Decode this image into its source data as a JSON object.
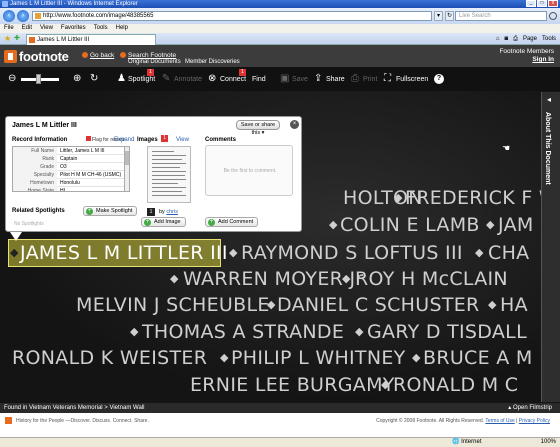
{
  "browser": {
    "title": "James L M Littler III - Windows Internet Explorer",
    "url": "http://www.footnote.com/image/48385565",
    "search_placeholder": "Live Search",
    "menu": [
      "File",
      "Edit",
      "View",
      "Favorites",
      "Tools",
      "Help"
    ],
    "tab_label": "James L M Littler III",
    "commands": [
      "Page",
      "Tools"
    ],
    "status_zone": "Internet",
    "zoom": "100%"
  },
  "header": {
    "logo_text": "footnote",
    "go_back": "Go back",
    "search_footnote": "Search Footnote",
    "original_documents": "Original Documents",
    "member_discoveries": "Member Discoveries",
    "footnote_members": "Footnote Members",
    "sign_in": "Sign In"
  },
  "toolbar": {
    "spotlight": "Spotlight",
    "spotlight_badge": "1",
    "annotate": "Annotate",
    "connect": "Connect",
    "connect_badge": "1",
    "find": "Find",
    "save": "Save",
    "share": "Share",
    "print": "Print",
    "fullscreen": "Fullscreen",
    "help": "?",
    "zoom_level": 0.45
  },
  "side_tab": {
    "label": "About This Document"
  },
  "card": {
    "title": "James L M Littler III",
    "save_share": "Save or share this",
    "record_info_label": "Record Information",
    "flag_label": "Flag for review",
    "expand": "Expand",
    "record_rows": [
      {
        "key": "Full Name",
        "value": "Littler, James L M III"
      },
      {
        "key": "Rank",
        "value": "Captain"
      },
      {
        "key": "Grade",
        "value": "O3"
      },
      {
        "key": "Specialty",
        "value": "Pilot H M M CH-46 (USMC)"
      },
      {
        "key": "Hometown",
        "value": "Honolulu"
      },
      {
        "key": "Home State",
        "value": "HI"
      }
    ],
    "images_label": "Images",
    "images_badge": "1",
    "view": "View",
    "image_number": "1",
    "by_label": "by",
    "by_user": "chris",
    "comments_label": "Comments",
    "first_comment": "Be the first to comment.",
    "related_spotlights": "Related Spotlights",
    "no_spotlights": "No Spotlights",
    "make_spotlight": "Make Spotlight",
    "add_image": "Add Image",
    "add_comment": "Add Comment"
  },
  "wall": {
    "names": [
      {
        "text": "HOLTON"
      },
      {
        "text": "FREDERICK F W"
      },
      {
        "text": "COLIN E LAMB"
      },
      {
        "text": "JAM"
      },
      {
        "text": "JAMES L M LITTLER III"
      },
      {
        "text": "RAYMOND S LOFTUS III"
      },
      {
        "text": "CHA"
      },
      {
        "text": "WARREN MOYER Jr"
      },
      {
        "text": "ROY H McCLAIN"
      },
      {
        "text": "MELVIN J SCHEUBLE"
      },
      {
        "text": "DANIEL C SCHUSTER"
      },
      {
        "text": "HA"
      },
      {
        "text": "THOMAS A STRANDE"
      },
      {
        "text": "GARY D TISDALL"
      },
      {
        "text": "RONALD K WEISTER"
      },
      {
        "text": "PHILIP L WHITNEY"
      },
      {
        "text": "BRUCE A M"
      },
      {
        "text": "ERNIE LEE BURGAMY"
      },
      {
        "text": "RONALD M C"
      }
    ]
  },
  "footer": {
    "found_in": "Found in  Vietnam Veterans Memorial > Vietnam Wall",
    "open_filmstrip": "Open Filmstrip",
    "tagline": "History for the People —Discover. Discuss. Connect. Share.",
    "copyright": "Copyright © 2008 Footnote. All Rights Reserved.",
    "terms": "Terms of Use",
    "privacy": "Privacy Policy"
  },
  "colors": {
    "accent": "#e56b1f",
    "toolbar_bg": "#111111",
    "highlight": "#d2cd3c"
  }
}
